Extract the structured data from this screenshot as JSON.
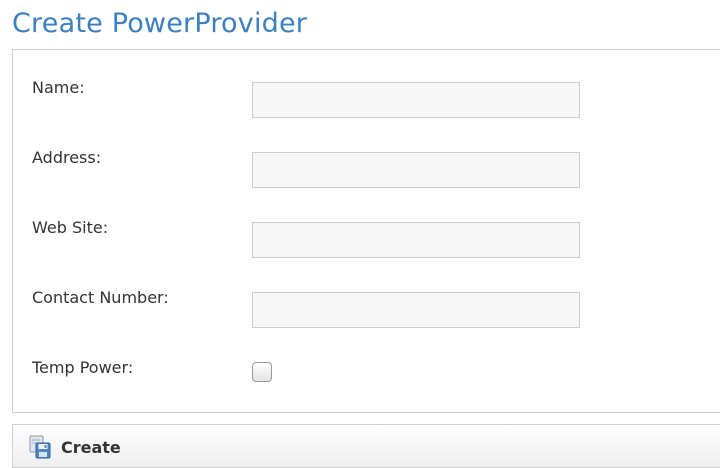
{
  "page": {
    "title": "Create PowerProvider"
  },
  "form": {
    "fields": [
      {
        "label": "Name:",
        "value": ""
      },
      {
        "label": "Address:",
        "value": ""
      },
      {
        "label": "Web Site:",
        "value": ""
      },
      {
        "label": "Contact Number:",
        "value": ""
      }
    ],
    "temp_power": {
      "label": "Temp Power:",
      "checked": false
    }
  },
  "actions": {
    "create_label": "Create",
    "create_icon": "save-disk-icon"
  },
  "colors": {
    "title": "#3a7fc1",
    "border": "#cfcfcf",
    "input_background": "#f7f7f7"
  }
}
